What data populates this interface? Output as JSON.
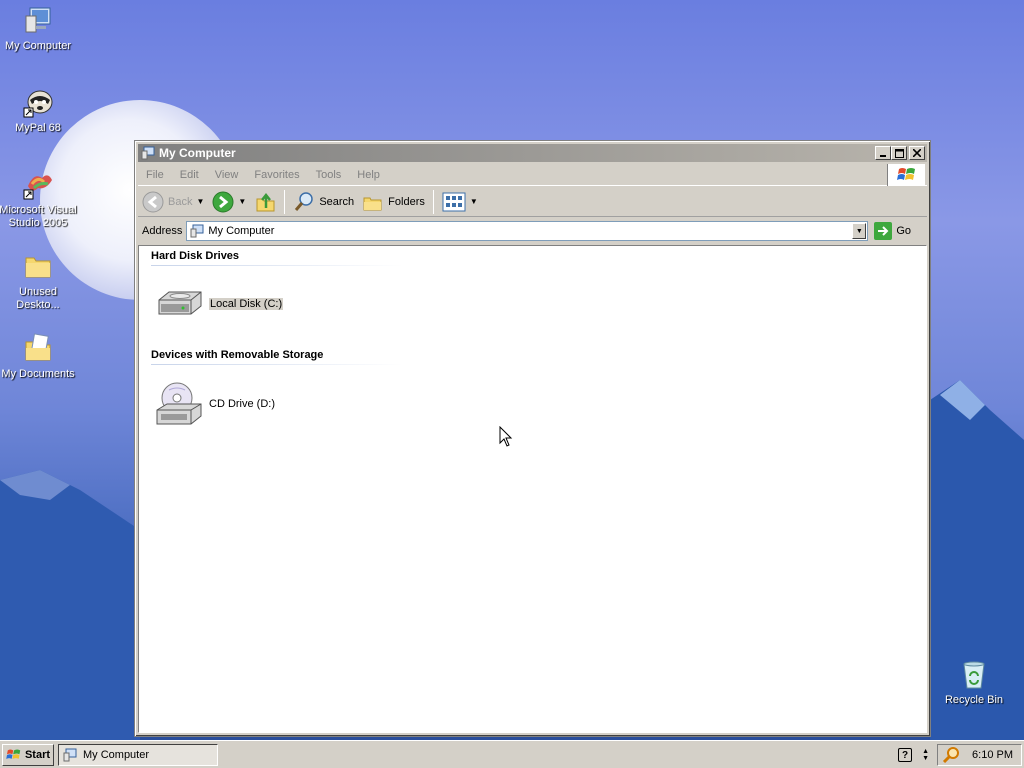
{
  "desktop": {
    "icons": [
      {
        "label": "My Computer",
        "icon": "my-computer-icon"
      },
      {
        "label": "MyPal 68",
        "icon": "raccoon-shortcut-icon"
      },
      {
        "label": "Microsoft Visual Studio 2005",
        "icon": "visual-studio-shortcut-icon"
      },
      {
        "label": "Unused Deskto...",
        "icon": "folder-icon"
      },
      {
        "label": "My Documents",
        "icon": "my-documents-icon"
      },
      {
        "label": "Recycle Bin",
        "icon": "recycle-bin-icon"
      }
    ]
  },
  "window": {
    "title": "My Computer",
    "menu": [
      "File",
      "Edit",
      "View",
      "Favorites",
      "Tools",
      "Help"
    ],
    "toolbar": {
      "back_label": "Back",
      "search_label": "Search",
      "folders_label": "Folders"
    },
    "address": {
      "label": "Address",
      "value": "My Computer",
      "go_label": "Go"
    },
    "groups": [
      {
        "header": "Hard Disk Drives",
        "items": [
          {
            "label": "Local Disk (C:)",
            "icon": "hard-disk-icon"
          }
        ]
      },
      {
        "header": "Devices with Removable Storage",
        "items": [
          {
            "label": "CD Drive (D:)",
            "icon": "cd-drive-icon"
          }
        ]
      }
    ]
  },
  "taskbar": {
    "start_label": "Start",
    "task_label": "My Computer",
    "clock": "6:10 PM",
    "help_glyph": "?"
  },
  "colors": {
    "title_bar_inactive": "#808080",
    "desktop_sky": "#6a7ee0",
    "chrome": "#d4d0c8"
  }
}
